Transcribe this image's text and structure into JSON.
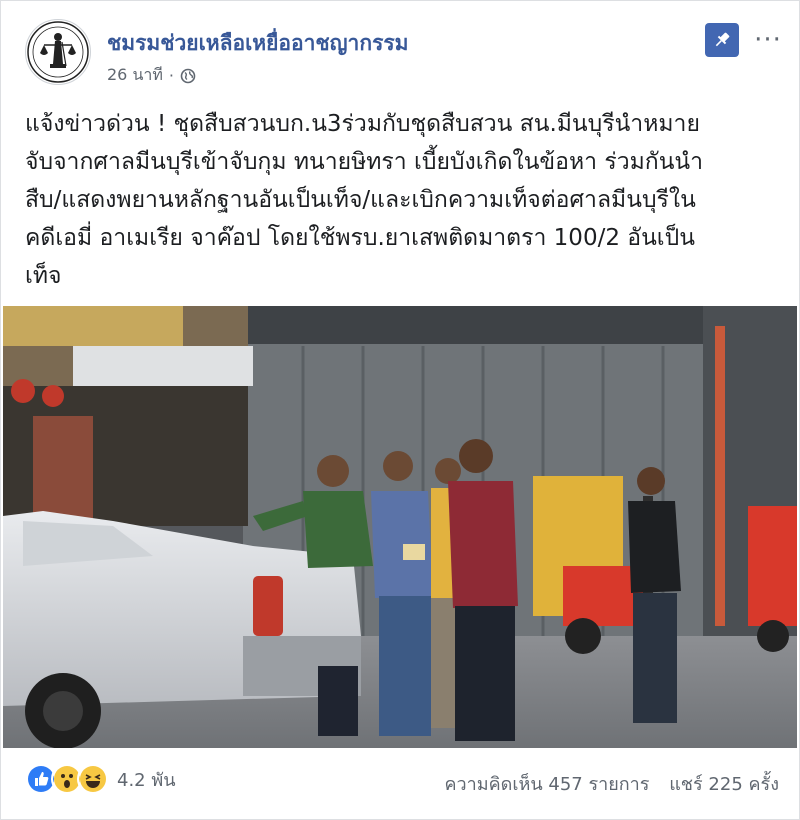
{
  "post": {
    "page_name": "ชมรมช่วยเหลือเหยื่ออาชญากรรม",
    "time": "26 นาที",
    "separator": "·",
    "audience_icon": "globe-icon",
    "body": "แจ้งข่าวด่วน ! ชุดสืบสวนบก.น3ร่วมกับชุดสืบสวน สน.มีนบุรีนำหมาย\nจับจากศาลมีนบุรีเข้าจับกุม ทนายษิทรา เบี้ยบังเกิดในข้อหา ร่วมกันนำ\nสืบ/แสดงพยานหลักฐานอันเป็นเท็จ/และเบิกความเท็จต่อศาลมีนบุรีใน\nคดีเอมี่ อาเมเรีย จาค๊อป โดยใช้พรบ.ยาเสพติดมาตรา 100/2 อันเป็น\nเท็จ"
  },
  "footer": {
    "reaction_count": "4.2 พัน",
    "comments": "ความคิดเห็น 457 รายการ",
    "shares": "แชร์ 225 ครั้ง",
    "reaction_icons": [
      "like-icon",
      "wow-icon",
      "haha-icon"
    ]
  },
  "colors": {
    "link_blue": "#385898",
    "pin_blue": "#4267b2",
    "meta_gray": "#606770"
  }
}
